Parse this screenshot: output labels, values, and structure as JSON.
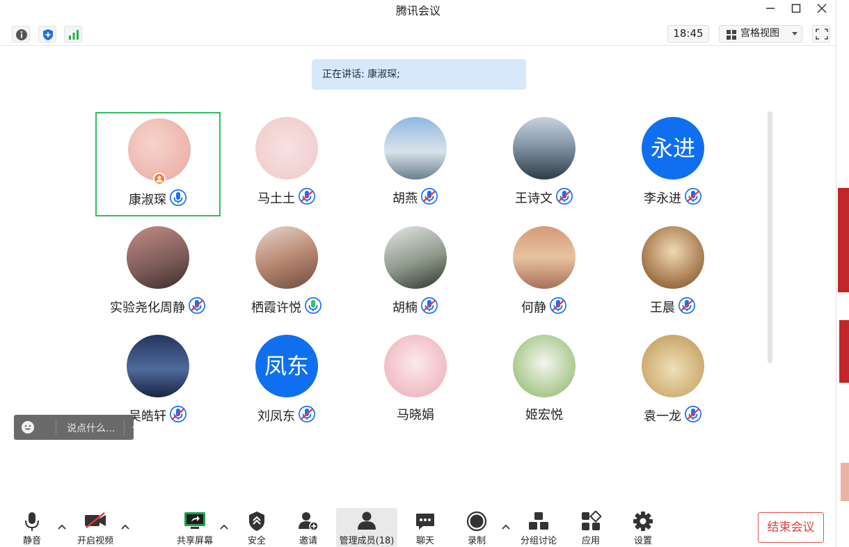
{
  "window": {
    "title": "腾讯会议"
  },
  "topbar": {
    "time": "18:45",
    "view_label": "宫格视图"
  },
  "speaking": {
    "label": "正在讲话: 康淑琛;"
  },
  "participants": [
    {
      "name": "康淑琛"
    },
    {
      "name": "马土土"
    },
    {
      "name": "胡燕"
    },
    {
      "name": "王诗文"
    },
    {
      "name": "李永进",
      "avatar_text": "永进"
    },
    {
      "name": "实验尧化周静"
    },
    {
      "name": "栖霞许悦"
    },
    {
      "name": "胡楠"
    },
    {
      "name": "何静"
    },
    {
      "name": "王晨"
    },
    {
      "name": "吴皓轩"
    },
    {
      "name": "刘凤东",
      "avatar_text": "凤东"
    },
    {
      "name": "马晓娟"
    },
    {
      "name": "姬宏悦"
    },
    {
      "name": "袁一龙"
    }
  ],
  "chat": {
    "placeholder": "说点什么..."
  },
  "toolbar": {
    "mute": "静音",
    "video": "开启视频",
    "share": "共享屏幕",
    "security": "安全",
    "invite": "邀请",
    "members": "管理成员(18)",
    "chat": "聊天",
    "record": "录制",
    "breakout": "分组讨论",
    "apps": "应用",
    "settings": "设置",
    "end": "结束会议"
  },
  "colors": {
    "accent": "#0f6ff0",
    "active_border": "#2ebd5f",
    "end": "#e03c3c"
  }
}
